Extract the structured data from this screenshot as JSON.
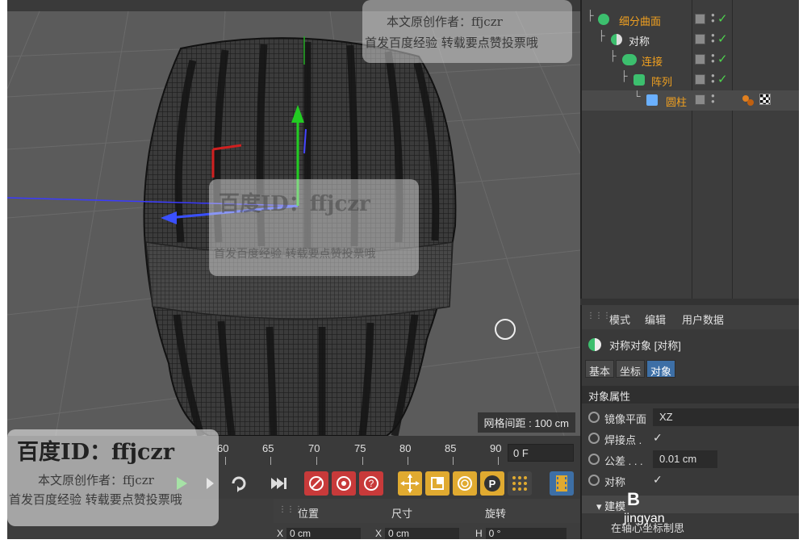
{
  "viewport": {
    "grid_spacing_label": "网格间距 : 100 cm"
  },
  "object_manager": {
    "objects": [
      {
        "label": "细分曲面"
      },
      {
        "label": "对称"
      },
      {
        "label": "连接"
      },
      {
        "label": "阵列"
      },
      {
        "label": "圆柱"
      }
    ]
  },
  "attribute_manager": {
    "menu": [
      "模式",
      "编辑",
      "用户数据"
    ],
    "object_title": "对称对象 [对称]",
    "tabs": [
      "基本",
      "坐标",
      "对象"
    ],
    "active_tab": "对象",
    "section_title": "对象属性",
    "params": {
      "mirror_plane_label": "镜像平面",
      "mirror_plane_value": "XZ",
      "weld_points_label": "焊接点 .",
      "tolerance_label": "公差 . . .",
      "tolerance_value": "0.01 cm",
      "symmetry_label": "对称"
    },
    "construct_label": "建模",
    "construct_note": "在轴心坐标制思"
  },
  "timeline": {
    "ticks": [
      "60",
      "65",
      "70",
      "75",
      "80",
      "85",
      "90"
    ],
    "frame_value": "0 F"
  },
  "coordinates": {
    "headers": [
      "位置",
      "尺寸",
      "旋转"
    ],
    "x_label": "X",
    "x_pos": "0 cm",
    "x_size_label": "X",
    "x_size": "0 cm",
    "h_label": "H",
    "h_rot": "0 °"
  },
  "watermarks": {
    "author_line": "本文原创作者：ffjczr",
    "publish_line": "首发百度经验  转载要点赞投票哦",
    "baidu_id": "百度ID：ffjczr",
    "corner_brand": "jingyan"
  },
  "colors": {
    "accent_orange": "#f0a020",
    "active_tab_blue": "#3d6fa6",
    "check_green": "#4ed44e"
  }
}
